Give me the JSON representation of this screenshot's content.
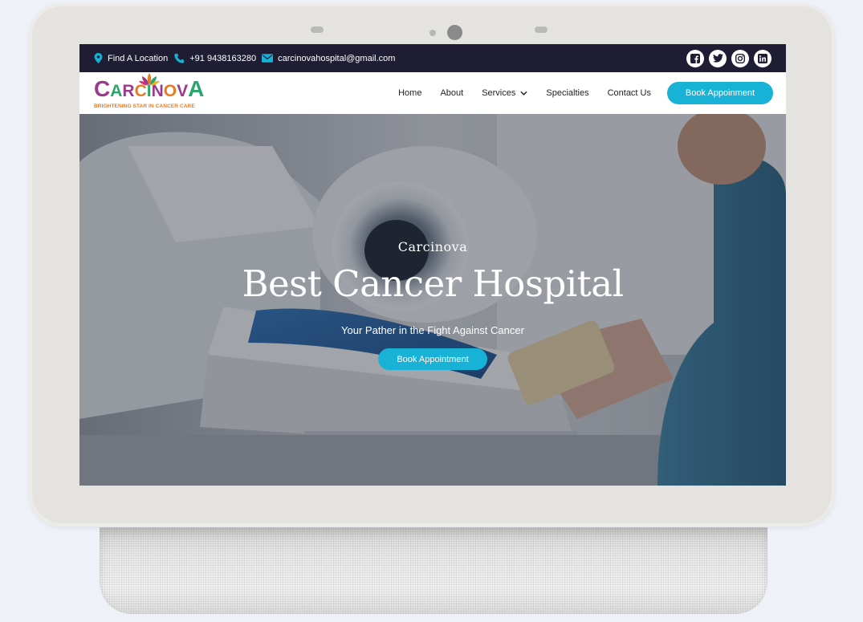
{
  "topbar": {
    "location_label": "Find A Location",
    "phone": "+91 9438163280",
    "email": "carcinovahospital@gmail.com",
    "socials": [
      "facebook-icon",
      "twitter-icon",
      "instagram-icon",
      "linkedin-icon"
    ]
  },
  "navbar": {
    "logo": {
      "letters": [
        "C",
        "A",
        "R",
        "C",
        "I",
        "N",
        "O",
        "V",
        "A"
      ],
      "tagline": "BRIGHTENING STAR IN CANCER CARE"
    },
    "menu": [
      {
        "label": "Home"
      },
      {
        "label": "About"
      },
      {
        "label": "Services"
      },
      {
        "label": "Specialties"
      },
      {
        "label": "Contact Us"
      }
    ],
    "cta_label": "Book Appoinment"
  },
  "hero": {
    "kicker": "Carcinova",
    "title": "Best Cancer Hospital",
    "subtitle": "Your Pather in the Fight Against Cancer",
    "cta_label": "Book Appointment"
  },
  "colors": {
    "accent": "#17b2d6",
    "topbar_bg": "#1f1d33",
    "logo_purple": "#9a3a8e",
    "logo_green": "#2aa66a",
    "logo_orange": "#e87b1e"
  }
}
